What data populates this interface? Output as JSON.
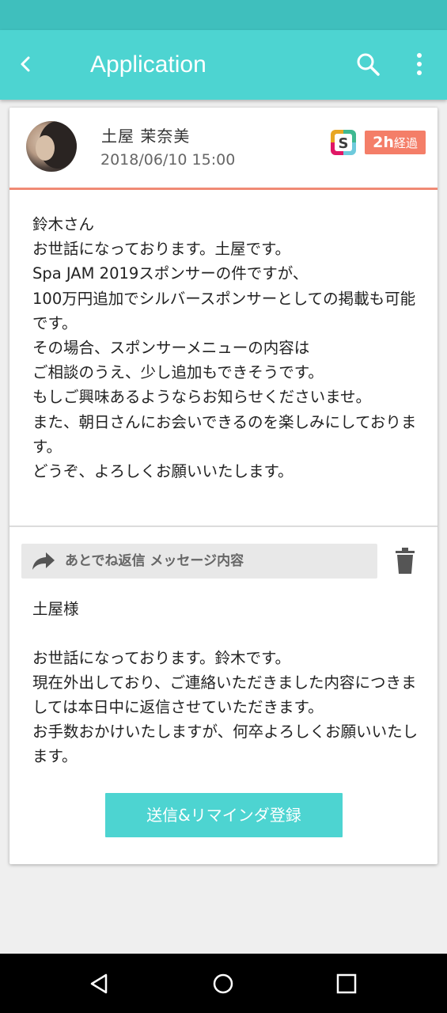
{
  "app": {
    "title": "Application"
  },
  "message": {
    "sender": "土屋 茉奈美",
    "datetime": "2018/06/10 15:00",
    "source_icon": "slack-icon",
    "elapsed_badge_num": "2h",
    "elapsed_badge_unit": "経過",
    "body": "鈴木さん\nお世話になっております。土屋です。\nSpa JAM 2019スポンサーの件ですが、\n100万円追加でシルバースポンサーとしての掲載も可能です。\nその場合、スポンサーメニューの内容は\nご相談のうえ、少し追加もできそうです。\nもしご興味あるようならお知らせくださいませ。\nまた、朝日さんにお会いできるのを楽しみにしております。\nどうぞ、よろしくお願いいたします。"
  },
  "reply": {
    "template_label": "あとでね返信 メッセージ内容",
    "text": "土屋様\n\nお世話になっております。鈴木です。\n現在外出しており、ご連絡いただきました内容につきましては本日中に返信させていただきます。\nお手数おかけいたしますが、何卒よろしくお願いいたします。",
    "send_button": "送信&リマインダ登録"
  },
  "colors": {
    "appbar": "#4dd4d1",
    "statusbar": "#3fbfbd",
    "badge": "#f47e68",
    "accent_line": "#f08a74"
  }
}
